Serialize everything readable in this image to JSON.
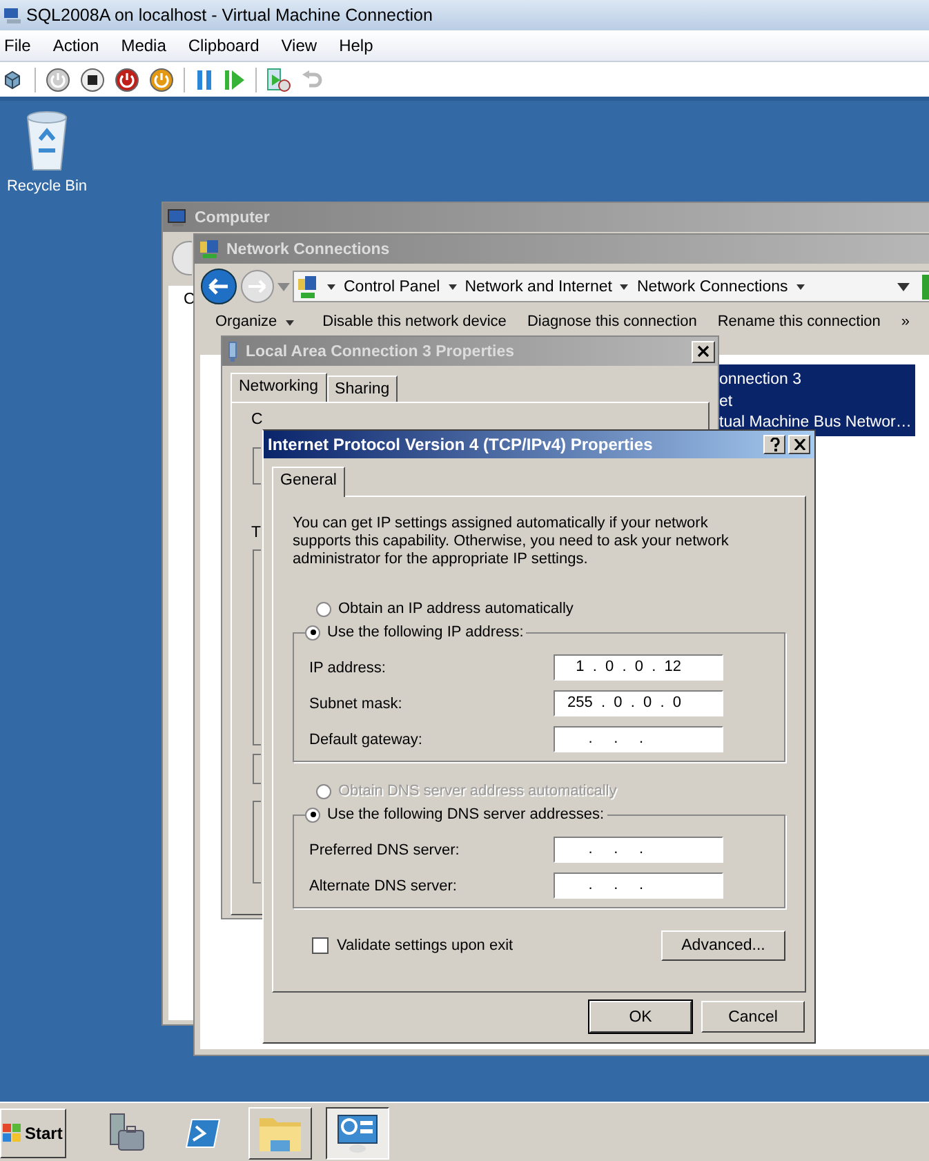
{
  "host_window": {
    "title": "SQL2008A on localhost - Virtual Machine Connection",
    "menu": [
      "File",
      "Action",
      "Media",
      "Clipboard",
      "View",
      "Help"
    ]
  },
  "desktop_icons": [
    {
      "label": "Recycle Bin"
    }
  ],
  "computer_window": {
    "title": "Computer",
    "fragment": "C"
  },
  "network_window": {
    "title": "Network Connections",
    "breadcrumb": [
      "Control Panel",
      "Network and Internet",
      "Network Connections"
    ],
    "commands": [
      "Organize",
      "Disable this network device",
      "Diagnose this connection",
      "Rename this connection",
      "»"
    ],
    "selected_item": [
      "onnection 3",
      "et",
      "tual Machine Bus Networ…"
    ]
  },
  "lan_dialog": {
    "title": "Local Area Connection 3 Properties",
    "tabs": [
      {
        "label": "Networking",
        "selected": true
      },
      {
        "label": "Sharing",
        "selected": false
      }
    ],
    "fragments": [
      "C",
      "T"
    ]
  },
  "ipv4_dialog": {
    "title": "Internet Protocol Version 4 (TCP/IPv4) Properties",
    "tabs": [
      {
        "label": "General",
        "selected": true
      }
    ],
    "description": "You can get IP settings assigned automatically if your network supports this capability. Otherwise, you need to ask your network administrator for the appropriate IP settings.",
    "ip_options": [
      {
        "label": "Obtain an IP address automatically",
        "selected": false,
        "disabled": false
      },
      {
        "label": "Use the following IP address:",
        "selected": true,
        "disabled": false
      }
    ],
    "ip_fields": [
      {
        "label": "IP address:",
        "value": "  1  .  0  .  0  .  12"
      },
      {
        "label": "Subnet mask:",
        "value": "255  .  0  .  0  .  0"
      },
      {
        "label": "Default gateway:",
        "value": "     .     .     ."
      }
    ],
    "dns_options": [
      {
        "label": "Obtain DNS server address automatically",
        "selected": false,
        "disabled": true
      },
      {
        "label": "Use the following DNS server addresses:",
        "selected": true,
        "disabled": false
      }
    ],
    "dns_fields": [
      {
        "label": "Preferred DNS server:",
        "value": "     .     .     ."
      },
      {
        "label": "Alternate DNS server:",
        "value": "     .     .     ."
      }
    ],
    "validate": {
      "label": "Validate settings upon exit",
      "checked": false
    },
    "advanced_button": "Advanced...",
    "ok_button": "OK",
    "cancel_button": "Cancel"
  },
  "taskbar": {
    "start": "Start",
    "buttons": [
      {
        "open": false,
        "active": false
      },
      {
        "open": false,
        "active": false
      },
      {
        "open": true,
        "active": false
      },
      {
        "open": true,
        "active": true
      }
    ]
  }
}
